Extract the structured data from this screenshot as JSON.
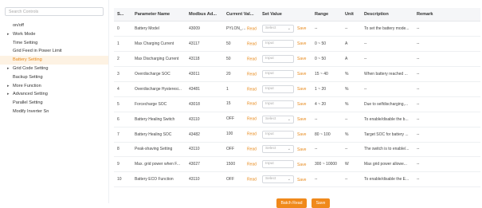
{
  "sidebar": {
    "search_placeholder": "Search Controls",
    "items": [
      {
        "label": "on/off"
      },
      {
        "label": "Work Mode"
      },
      {
        "label": "Time Setting"
      },
      {
        "label": "Grid Feed in Power Limit"
      },
      {
        "label": "Battery Setting"
      },
      {
        "label": "Grid Code Setting"
      },
      {
        "label": "Backup Setting"
      },
      {
        "label": "More Function"
      },
      {
        "label": "Advanced Setting"
      },
      {
        "label": "Parallel Setting"
      },
      {
        "label": "Modify Inverter Sn"
      }
    ],
    "caret_icon": "▸"
  },
  "table": {
    "headers": {
      "serial": "S...",
      "parameter": "Parameter Name",
      "modbus": "Modbus Ad...",
      "current": "Current Val...",
      "set_value": "Set Value",
      "range": "Range",
      "unit": "Unit",
      "description": "Description",
      "remark": "Remark"
    },
    "read_label": "Read",
    "save_label": "Save",
    "select_placeholder": "Select",
    "input_placeholder": "Input",
    "rows": [
      {
        "sn": "0",
        "name": "Battery Model",
        "addr": "43009",
        "cur": "PYLON_HV",
        "ctl": "Select",
        "range": "--",
        "unit": "--",
        "desc": "To set the battery mode...",
        "remark": "--"
      },
      {
        "sn": "1",
        "name": "Max Charging Current",
        "addr": "43117",
        "cur": "50",
        "ctl": "Input",
        "range": "0 ~ 50",
        "unit": "A",
        "desc": "--",
        "remark": "--"
      },
      {
        "sn": "2",
        "name": "Max Discharging Current",
        "addr": "43118",
        "cur": "50",
        "ctl": "Input",
        "range": "0 ~ 50",
        "unit": "A",
        "desc": "--",
        "remark": "--"
      },
      {
        "sn": "3",
        "name": "Overdischarge SOC",
        "addr": "43011",
        "cur": "20",
        "ctl": "Input",
        "range": "15 ~ 40",
        "unit": "%",
        "desc": "When battery reached ...",
        "remark": "--"
      },
      {
        "sn": "4",
        "name": "Overdischarge Hysteresi...",
        "addr": "43481",
        "cur": "1",
        "ctl": "Input",
        "range": "1 ~ 20",
        "unit": "%",
        "desc": "--",
        "remark": "--"
      },
      {
        "sn": "5",
        "name": "Forcecharge SOC",
        "addr": "43018",
        "cur": "15",
        "ctl": "Input",
        "range": "4 ~ 20",
        "unit": "%",
        "desc": "Due to selfdischarging,...",
        "remark": "--"
      },
      {
        "sn": "6",
        "name": "Battery Healing Switch",
        "addr": "43110",
        "cur": "OFF",
        "ctl": "Select",
        "range": "--",
        "unit": "--",
        "desc": "To enable/disable the b...",
        "remark": "--"
      },
      {
        "sn": "7",
        "name": "Battery Healing SOC",
        "addr": "43482",
        "cur": "100",
        "ctl": "Input",
        "range": "80 ~ 100",
        "unit": "%",
        "desc": "Target SOC for battery ...",
        "remark": "--"
      },
      {
        "sn": "8",
        "name": "Peak-shaving Setting",
        "addr": "43110",
        "cur": "OFF",
        "ctl": "Select",
        "range": "--",
        "unit": "--",
        "desc": "The switch is to enable/...",
        "remark": "--"
      },
      {
        "sn": "9",
        "name": "Max. grid power when F...",
        "addr": "43027",
        "cur": "1500",
        "ctl": "Input",
        "range": "300 ~ 10000",
        "unit": "W",
        "desc": "Max grid power allowe...",
        "remark": "--"
      },
      {
        "sn": "10",
        "name": "Battery ECO Function",
        "addr": "43110",
        "cur": "OFF",
        "ctl": "Select",
        "range": "--",
        "unit": "--",
        "desc": "To enable/disable the E...",
        "remark": "--"
      }
    ]
  },
  "footer": {
    "batch_read_label": "Batch Read",
    "save_label": "Save"
  },
  "colors": {
    "accent": "#f0891b",
    "active_bg": "#fdf2e3"
  }
}
